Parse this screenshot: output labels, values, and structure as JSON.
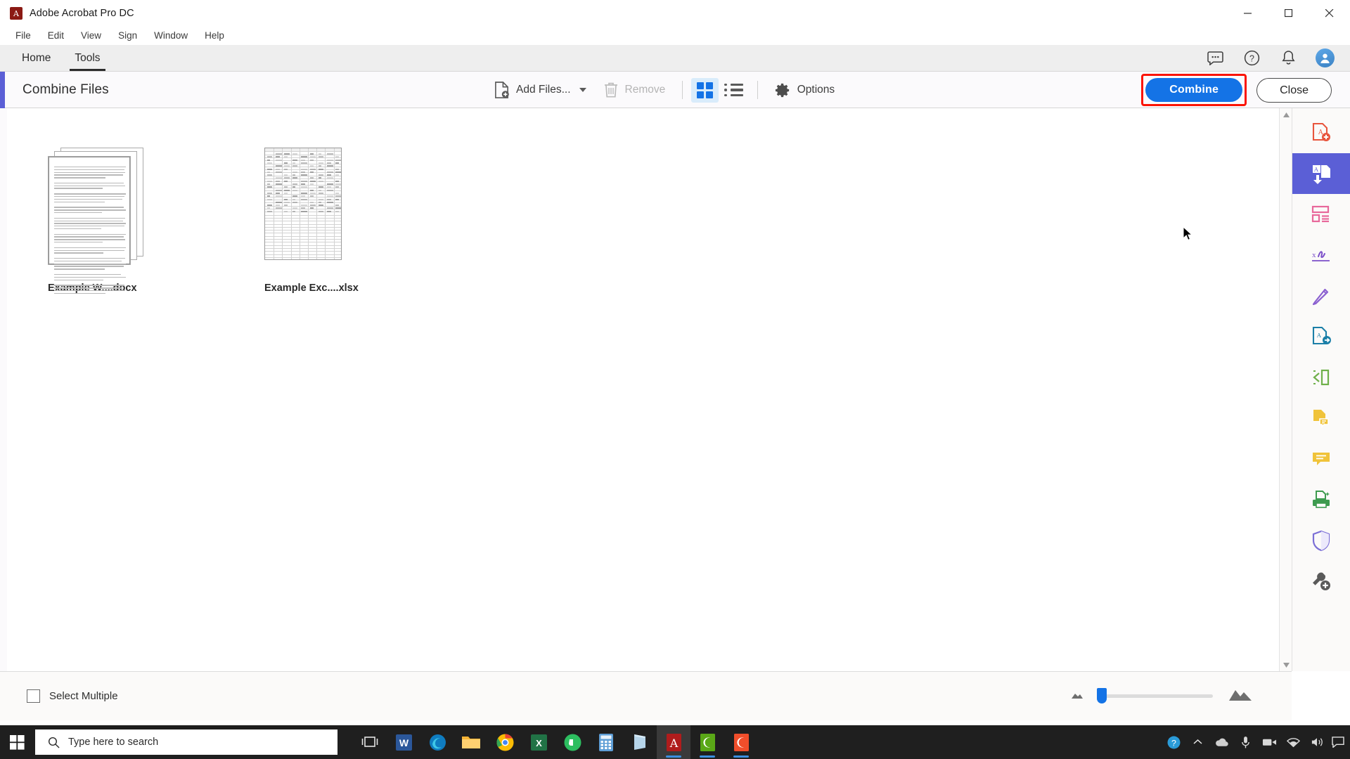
{
  "window": {
    "title": "Adobe Acrobat Pro DC",
    "app_icon": "acrobat-icon",
    "minimize_label": "—",
    "maximize_label": "☐",
    "close_label": "✕"
  },
  "menubar": {
    "items": [
      {
        "label": "File"
      },
      {
        "label": "Edit"
      },
      {
        "label": "View"
      },
      {
        "label": "Sign"
      },
      {
        "label": "Window"
      },
      {
        "label": "Help"
      }
    ]
  },
  "apptabs": {
    "items": [
      {
        "label": "Home",
        "active": false
      },
      {
        "label": "Tools",
        "active": true
      }
    ],
    "right_icons": [
      {
        "name": "comment-icon"
      },
      {
        "name": "help-icon"
      },
      {
        "name": "bell-icon"
      },
      {
        "name": "avatar"
      }
    ]
  },
  "combine": {
    "title": "Combine Files",
    "accent_color": "#5b5fd6",
    "add_files_label": "Add Files...",
    "remove_label": "Remove",
    "remove_disabled": true,
    "options_label": "Options",
    "grid_view_active": true,
    "list_view_active": false,
    "combine_label": "Combine",
    "close_label": "Close",
    "combine_color": "#1473e6",
    "highlight_color": "#fb1405"
  },
  "files": [
    {
      "name": "Example W....docx",
      "type": "word",
      "thumb": "document-pages-thumbnail"
    },
    {
      "name": "Example Exc....xlsx",
      "type": "excel",
      "thumb": "spreadsheet-thumbnail"
    }
  ],
  "bottom": {
    "select_multiple_label": "Select Multiple",
    "select_multiple_checked": false,
    "zoom_small_icon": "small-thumbnail-icon",
    "zoom_large_icon": "large-thumbnail-icon",
    "zoom_value": 6
  },
  "rail": {
    "items": [
      {
        "name": "create-pdf-icon",
        "selected": false
      },
      {
        "name": "combine-files-icon",
        "selected": true
      },
      {
        "name": "organize-pages-icon",
        "selected": false
      },
      {
        "name": "fill-and-sign-icon",
        "selected": false
      },
      {
        "name": "request-signatures-icon",
        "selected": false
      },
      {
        "name": "export-pdf-icon",
        "selected": false
      },
      {
        "name": "edit-pdf-icon",
        "selected": false
      },
      {
        "name": "comment-doc-icon",
        "selected": false
      },
      {
        "name": "comment-icon",
        "selected": false
      },
      {
        "name": "scan-and-ocr-icon",
        "selected": false
      },
      {
        "name": "protect-icon",
        "selected": false
      },
      {
        "name": "more-tools-icon",
        "selected": false
      }
    ]
  },
  "taskbar": {
    "start_icon": "windows-start-icon",
    "search_placeholder": "Type here to search",
    "search_icon": "search-icon",
    "task_view_icon": "task-view-icon",
    "apps": [
      {
        "name": "word-taskbar-icon",
        "running": false,
        "active": false
      },
      {
        "name": "edge-taskbar-icon",
        "running": false,
        "active": false
      },
      {
        "name": "file-explorer-taskbar-icon",
        "running": false,
        "active": false
      },
      {
        "name": "chrome-taskbar-icon",
        "running": false,
        "active": false
      },
      {
        "name": "excel-taskbar-icon",
        "running": false,
        "active": false
      },
      {
        "name": "evernote-taskbar-icon",
        "running": false,
        "active": false
      },
      {
        "name": "calculator-taskbar-icon",
        "running": false,
        "active": false
      },
      {
        "name": "onenote-taskbar-icon",
        "running": false,
        "active": false
      },
      {
        "name": "acrobat-taskbar-icon",
        "running": true,
        "active": true
      },
      {
        "name": "camtasia-taskbar-icon",
        "running": true,
        "active": false
      },
      {
        "name": "camtasia-recorder-taskbar-icon",
        "running": true,
        "active": false
      }
    ],
    "tray": [
      {
        "name": "help-tray-icon"
      },
      {
        "name": "show-hidden-icons-icon"
      },
      {
        "name": "onedrive-tray-icon"
      },
      {
        "name": "microphone-tray-icon"
      },
      {
        "name": "camera-tray-icon"
      },
      {
        "name": "network-tray-icon"
      },
      {
        "name": "volume-tray-icon"
      }
    ],
    "action_center_icon": "action-center-icon"
  }
}
